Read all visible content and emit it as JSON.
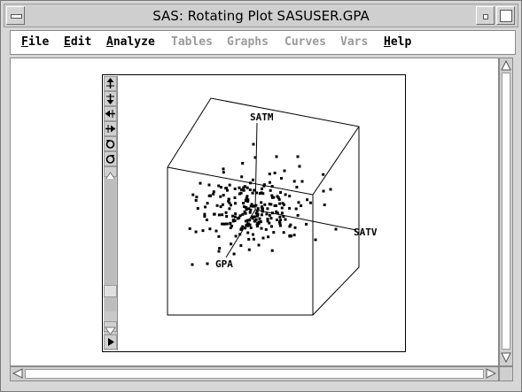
{
  "window": {
    "title": "SAS: Rotating Plot SASUSER.GPA"
  },
  "menu": {
    "items": [
      {
        "label": "File",
        "underline": "F",
        "rest": "ile",
        "enabled": true
      },
      {
        "label": "Edit",
        "underline": "E",
        "rest": "dit",
        "enabled": true
      },
      {
        "label": "Analyze",
        "underline": "A",
        "rest": "nalyze",
        "enabled": true
      },
      {
        "label": "Tables",
        "underline": "",
        "rest": "Tables",
        "enabled": false
      },
      {
        "label": "Graphs",
        "underline": "",
        "rest": "Graphs",
        "enabled": false
      },
      {
        "label": "Curves",
        "underline": "",
        "rest": "Curves",
        "enabled": false
      },
      {
        "label": "Vars",
        "underline": "",
        "rest": "Vars",
        "enabled": false
      },
      {
        "label": "Help",
        "underline": "H",
        "rest": "elp",
        "enabled": true
      }
    ]
  },
  "plot": {
    "axes": {
      "x": "SATV",
      "y": "SATM",
      "z": "GPA"
    },
    "tools": [
      "rotate-up-icon",
      "rotate-down-icon",
      "rotate-left-icon",
      "rotate-right-icon",
      "rotate-ccw-icon",
      "rotate-cw-icon"
    ]
  },
  "chart_data": {
    "type": "scatter",
    "title": "",
    "xlabel": "SATV",
    "ylabel": "SATM",
    "zlabel": "GPA",
    "note": "3D rotating scatter; values read as projected screen offsets relative to data cloud",
    "colors": {
      "points": "#000000",
      "frame": "#000000"
    }
  }
}
